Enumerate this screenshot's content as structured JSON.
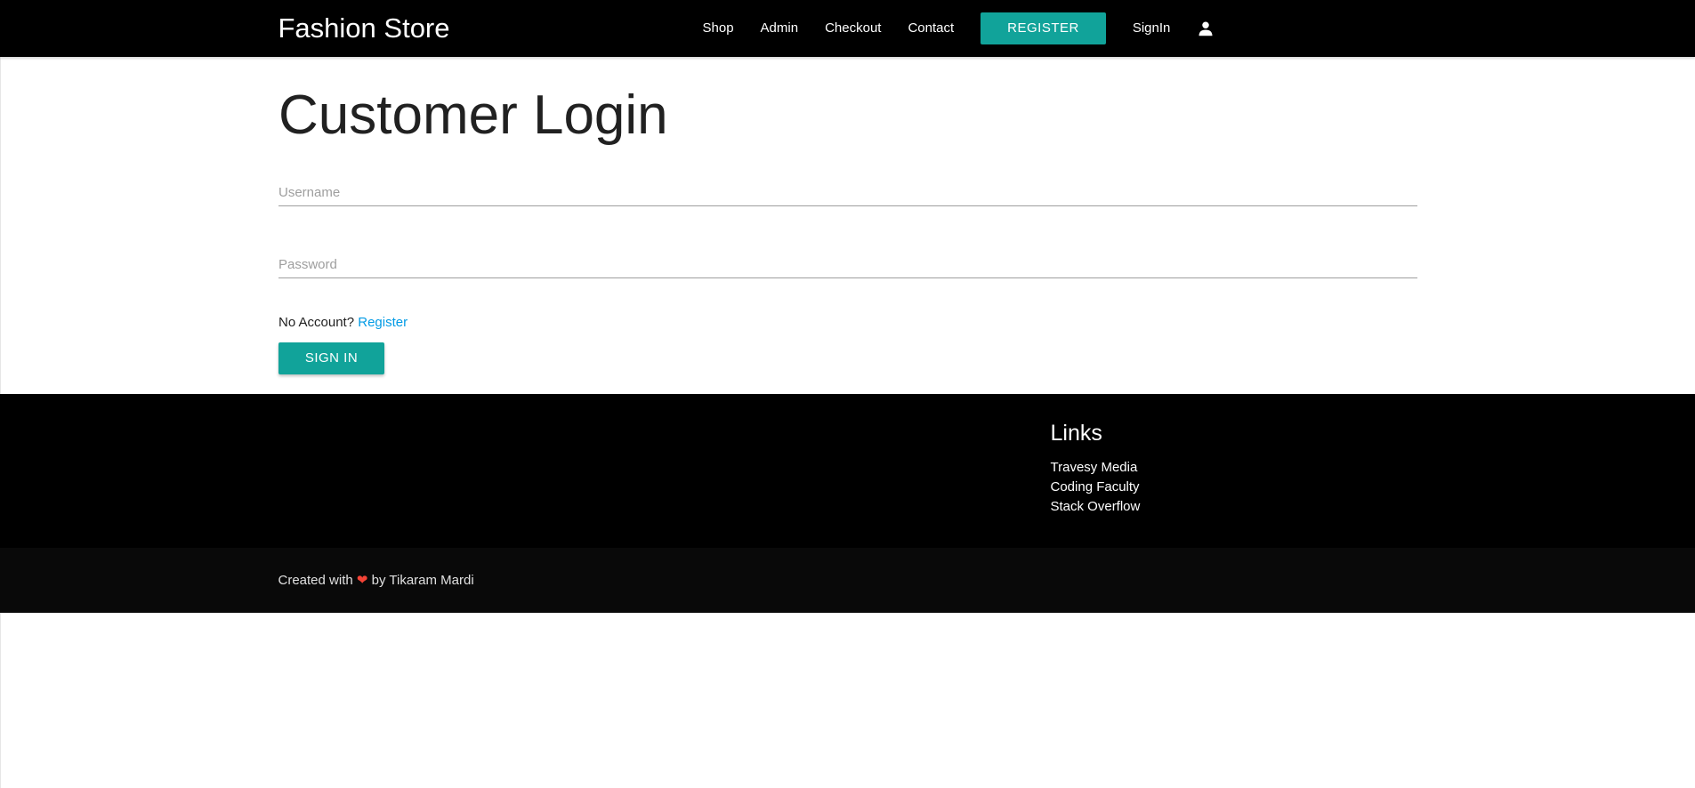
{
  "navbar": {
    "brand": "Fashion Store",
    "links": {
      "shop": "Shop",
      "admin": "Admin",
      "checkout": "Checkout",
      "contact": "Contact",
      "register": "REGISTER",
      "signin": "SignIn"
    },
    "account_icon": "person-icon",
    "background": "#000000",
    "accent": "#11a39a"
  },
  "login": {
    "title": "Customer Login",
    "username_placeholder": "Username",
    "password_placeholder": "Password",
    "no_account_text": "No Account?",
    "register_link": "Register",
    "signin_button": "SIGN IN"
  },
  "footer": {
    "links_title": "Links",
    "links": [
      "Travesy Media",
      "Coding Faculty",
      "Stack Overflow"
    ],
    "credit_prefix": "Created with",
    "heart": "❤",
    "credit_suffix": "by Tikaram Mardi"
  }
}
